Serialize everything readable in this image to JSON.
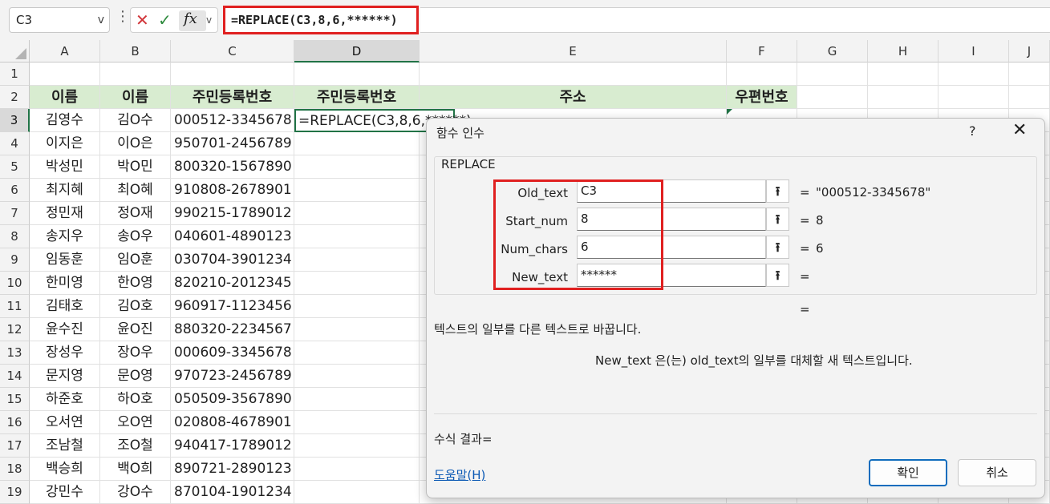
{
  "formula_bar": {
    "name_box": "C3",
    "name_box_chevron": "v",
    "more_icon": "⋮",
    "cancel_icon": "✕",
    "enter_icon": "✓",
    "fx_label": "fx",
    "fx_chevron": "v",
    "formula": "=REPLACE(C3,8,6,******)"
  },
  "columns": [
    "A",
    "B",
    "C",
    "D",
    "E",
    "F",
    "G",
    "H",
    "I",
    "J"
  ],
  "rows": [
    "1",
    "2",
    "3",
    "4",
    "5",
    "6",
    "7",
    "8",
    "9",
    "10",
    "11",
    "12",
    "13",
    "14",
    "15",
    "16",
    "17",
    "18",
    "19"
  ],
  "headers": {
    "a": "이름",
    "b": "이름",
    "c": "주민등록번호",
    "d": "주민등록번호",
    "e": "주소",
    "f": "우편번호"
  },
  "active_cell_text": "=REPLACE(C3,8,6,******)",
  "data_rows": [
    {
      "name": "김영수",
      "masked": "김O수",
      "id": "000512-3345678"
    },
    {
      "name": "이지은",
      "masked": "이O은",
      "id": "950701-2456789"
    },
    {
      "name": "박성민",
      "masked": "박O민",
      "id": "800320-1567890"
    },
    {
      "name": "최지혜",
      "masked": "최O혜",
      "id": "910808-2678901"
    },
    {
      "name": "정민재",
      "masked": "정O재",
      "id": "990215-1789012"
    },
    {
      "name": "송지우",
      "masked": "송O우",
      "id": "040601-4890123"
    },
    {
      "name": "임동훈",
      "masked": "임O훈",
      "id": "030704-3901234"
    },
    {
      "name": "한미영",
      "masked": "한O영",
      "id": "820210-2012345"
    },
    {
      "name": "김태호",
      "masked": "김O호",
      "id": "960917-1123456"
    },
    {
      "name": "윤수진",
      "masked": "윤O진",
      "id": "880320-2234567"
    },
    {
      "name": "장성우",
      "masked": "장O우",
      "id": "000609-3345678"
    },
    {
      "name": "문지영",
      "masked": "문O영",
      "id": "970723-2456789"
    },
    {
      "name": "하준호",
      "masked": "하O호",
      "id": "050509-3567890"
    },
    {
      "name": "오서연",
      "masked": "오O연",
      "id": "020808-4678901"
    },
    {
      "name": "조남철",
      "masked": "조O철",
      "id": "940417-1789012"
    },
    {
      "name": "백승희",
      "masked": "백O희",
      "id": "890721-2890123"
    },
    {
      "name": "강민수",
      "masked": "강O수",
      "id": "870104-1901234"
    }
  ],
  "dialog": {
    "title": "함수 인수",
    "help_icon": "?",
    "close_icon": "✕",
    "function_name": "REPLACE",
    "args": [
      {
        "label": "Old_text",
        "value": "C3",
        "result": "\"000512-3345678\""
      },
      {
        "label": "Start_num",
        "value": "8",
        "result": "8"
      },
      {
        "label": "Num_chars",
        "value": "6",
        "result": "6"
      },
      {
        "label": "New_text",
        "value": "******",
        "result": ""
      }
    ],
    "picker_icon": "⭱",
    "eq": "=",
    "description": "텍스트의 일부를 다른 텍스트로 바꿉니다.",
    "arg_description": "New_text  은(는) old_text의 일부를 대체할 새 텍스트입니다.",
    "result_label": "수식 결과=",
    "help_link": "도움말(H)",
    "ok_label": "확인",
    "cancel_label": "취소"
  },
  "accent_colors": {
    "highlight_red": "#e02020",
    "excel_green": "#217346",
    "header_fill": "#d8ecd0"
  }
}
